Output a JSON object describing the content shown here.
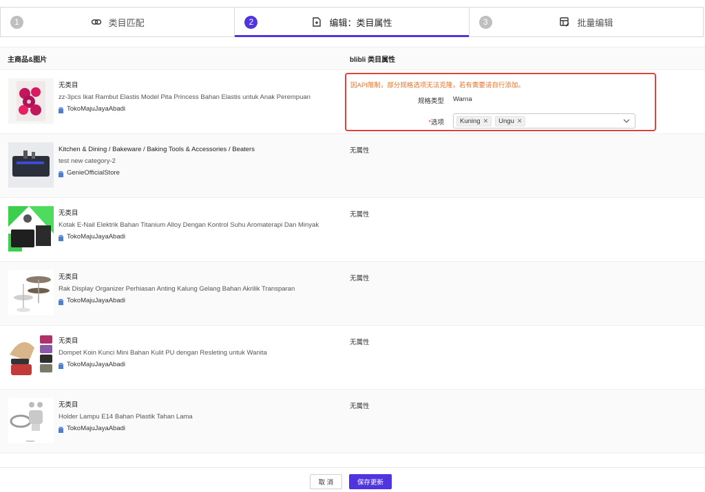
{
  "steps": [
    {
      "num": "1",
      "label": "类目匹配",
      "icon": "link-icon"
    },
    {
      "num": "2",
      "label": "编辑：类目属性",
      "icon": "edit-doc-icon"
    },
    {
      "num": "3",
      "label": "批量编辑",
      "icon": "batch-edit-icon"
    }
  ],
  "table": {
    "col1": "主商品&图片",
    "col2": "blibli 类目属性"
  },
  "rows": [
    {
      "category": "无类目",
      "title": "zz-3pcs Ikat Rambut Elastis Model Pita Princess Bahan Elastis untuk Anak Perempuan",
      "store": "TokoMajuJayaAbadi",
      "attr": ""
    },
    {
      "category": "Kitchen & Dining / Bakeware / Baking Tools & Accessories / Beaters",
      "title": "test new category-2",
      "store": "GenieOfficialStore",
      "attr": "无属性"
    },
    {
      "category": "无类目",
      "title": "Kotak E-Nail Elektrik Bahan Titanium Alloy Dengan Kontrol Suhu Aromaterapi Dan Minyak",
      "store": "TokoMajuJayaAbadi",
      "attr": "无属性"
    },
    {
      "category": "无类目",
      "title": "Rak Display Organizer Perhiasan Anting Kalung Gelang Bahan Akrilik Transparan",
      "store": "TokoMajuJayaAbadi",
      "attr": "无属性"
    },
    {
      "category": "无类目",
      "title": "Dompet Koin Kunci Mini Bahan Kulit PU dengan Resleting untuk Wanita",
      "store": "TokoMajuJayaAbadi",
      "attr": "无属性"
    },
    {
      "category": "无类目",
      "title": "Holder Lampu E14 Bahan Plastik Tahan Lama",
      "store": "TokoMajuJayaAbadi",
      "attr": "无属性"
    }
  ],
  "attr_box": {
    "warning": "因API限制，部分规格选项无法克隆，若有需要请自行添加。",
    "spec_type_label": "规格类型",
    "spec_type_value": "Warna",
    "required_mark": "*",
    "options_label": "选项",
    "options": [
      "Kuning",
      "Ungu"
    ]
  },
  "footer": {
    "cancel": "取 消",
    "save": "保存更新"
  },
  "colors": {
    "accent": "#4f35e0",
    "warning": "#e8732a",
    "highlight_border": "#e0423a"
  }
}
